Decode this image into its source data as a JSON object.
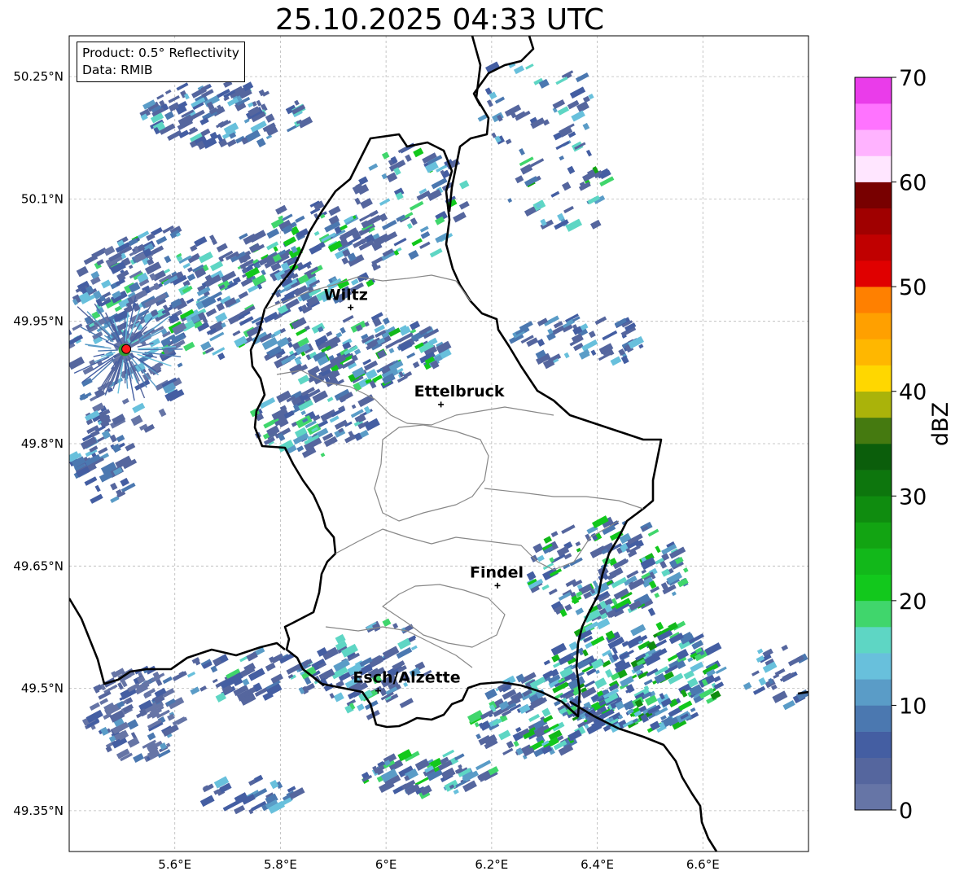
{
  "title": "25.10.2025 04:33 UTC",
  "info": {
    "product": "Product: 0.5° Reflectivity",
    "data": "Data: RMIB"
  },
  "map": {
    "lon_range": [
      5.4,
      6.8
    ],
    "lat_range": [
      49.3,
      50.3
    ],
    "lon_ticks": [
      "5.6°E",
      "5.8°E",
      "6°E",
      "6.2°E",
      "6.4°E",
      "6.6°E"
    ],
    "lat_ticks": [
      "50.25°N",
      "50.1°N",
      "49.95°N",
      "49.8°N",
      "49.65°N",
      "49.5°N",
      "49.35°N"
    ],
    "grid": true,
    "radar_site": {
      "lon": 5.505,
      "lat": 49.915
    },
    "cities": [
      {
        "name": "Wiltz",
        "lon": 5.933,
        "lat": 49.967
      },
      {
        "name": "Ettelbruck",
        "lon": 6.104,
        "lat": 49.848
      },
      {
        "name": "Findel",
        "lon": 6.211,
        "lat": 49.626
      },
      {
        "name": "Esch/Alzette",
        "lon": 5.985,
        "lat": 49.497
      }
    ]
  },
  "colorbar": {
    "label": "dBZ",
    "ticks": [
      "0",
      "10",
      "20",
      "30",
      "40",
      "50",
      "60",
      "70"
    ],
    "min": 0,
    "max": 70,
    "colors": [
      "#6675a6",
      "#55669e",
      "#445ea2",
      "#4b78b0",
      "#5a9cc7",
      "#68c0dc",
      "#5ed6c4",
      "#40d66c",
      "#12c81c",
      "#12b81a",
      "#12a412",
      "#0f8c0f",
      "#0d760d",
      "#0b5e0b",
      "#457a10",
      "#aab30a",
      "#ffd700",
      "#ffb700",
      "#ffa000",
      "#ff8000",
      "#e00000",
      "#c00000",
      "#a00000",
      "#780000",
      "#ffe6ff",
      "#ffb3ff",
      "#ff73ff",
      "#ea3cea"
    ]
  }
}
